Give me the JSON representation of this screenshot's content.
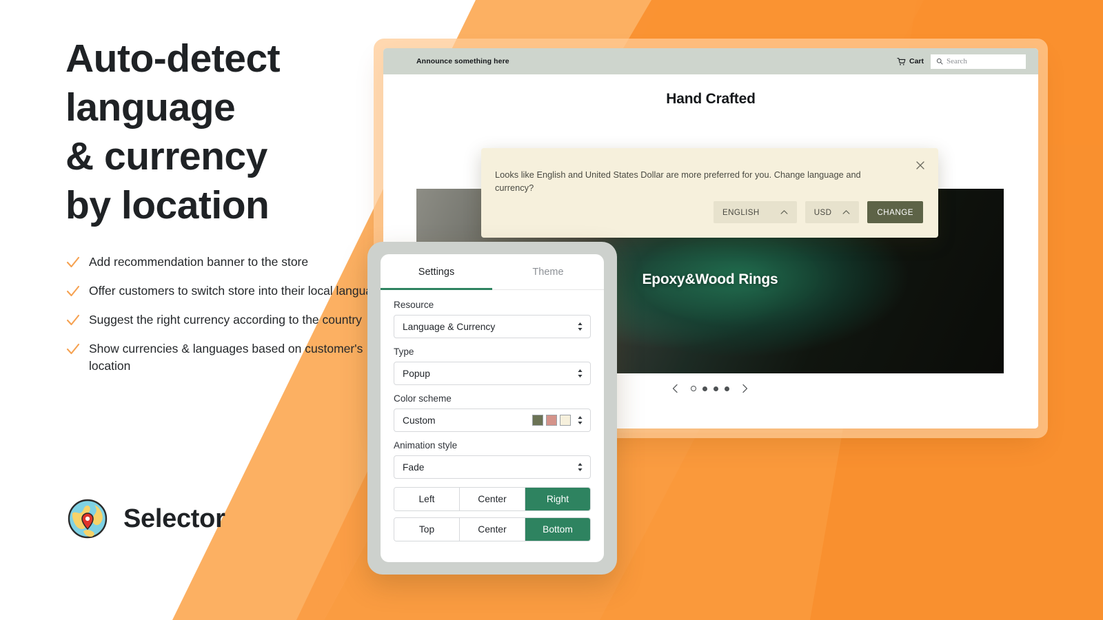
{
  "colors": {
    "orange_light": "#FCB062",
    "orange_mid": "#FBA44A",
    "orange_dark": "#F9902F",
    "accent_green": "#2E8360",
    "olive": "#5D6347",
    "cream": "#F6F0DC",
    "check_orange": "#F6A252"
  },
  "marketing": {
    "headline_lines": [
      "Auto-detect",
      "language",
      "& currency",
      "by location"
    ],
    "bullets": [
      {
        "icon": "check-icon",
        "text": "Add recommendation banner to the store"
      },
      {
        "icon": "check-icon",
        "text": "Offer customers to switch store into their local language"
      },
      {
        "icon": "check-icon",
        "text": "Suggest the right currency according to the country"
      },
      {
        "icon": "check-icon",
        "text": "Show currencies & languages based on customer's location"
      }
    ],
    "brand": {
      "logo_icon": "globe-pin-icon",
      "name": "Selector"
    }
  },
  "store": {
    "announcement": "Announce something here",
    "cart": {
      "icon": "cart-icon",
      "label": "Cart"
    },
    "search": {
      "icon": "search-icon",
      "placeholder": "Search"
    },
    "page_title": "Hand Crafted",
    "hero_caption": "Epoxy&Wood Rings",
    "carousel": {
      "prev_icon": "chevron-left-icon",
      "next_icon": "chevron-right-icon",
      "total_dots": 4,
      "active_index": 0
    }
  },
  "popup": {
    "message": "Looks like English and United States Dollar are more preferred for you. Change language and currency?",
    "close_icon": "close-icon",
    "language_select": {
      "value": "ENGLISH",
      "icon": "chevron-up-icon"
    },
    "currency_select": {
      "value": "USD",
      "icon": "chevron-up-icon"
    },
    "change_button": "CHANGE"
  },
  "settings": {
    "tabs": [
      {
        "label": "Settings",
        "active": true
      },
      {
        "label": "Theme",
        "active": false
      }
    ],
    "fields": [
      {
        "label": "Resource",
        "value": "Language & Currency",
        "icon": "updown-arrows-icon"
      },
      {
        "label": "Type",
        "value": "Popup",
        "icon": "updown-arrows-icon"
      },
      {
        "label": "Color scheme",
        "value": "Custom",
        "icon": "updown-arrows-icon",
        "swatches": [
          "#6B7355",
          "#D4938A",
          "#F6F0DC"
        ]
      },
      {
        "label": "Animation style",
        "value": "Fade",
        "icon": "updown-arrows-icon"
      }
    ],
    "horizontal_position": {
      "options": [
        "Left",
        "Center",
        "Right"
      ],
      "selected": "Right"
    },
    "vertical_position": {
      "options": [
        "Top",
        "Center",
        "Bottom"
      ],
      "selected": "Bottom"
    }
  }
}
